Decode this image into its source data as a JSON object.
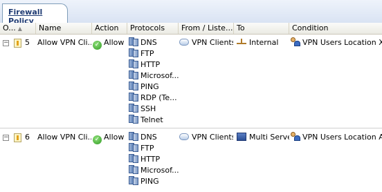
{
  "tab": {
    "label": "Firewall Policy"
  },
  "columns": {
    "order": "O...",
    "name": "Name",
    "action": "Action",
    "protocols": "Protocols",
    "from": "From / Liste...",
    "to": "To",
    "condition": "Condition"
  },
  "rules": [
    {
      "order": "5",
      "name": "Allow VPN Cli...",
      "action": "Allow",
      "protocols": [
        "DNS",
        "FTP",
        "HTTP",
        "Microsof...",
        "PING",
        "RDP (Te...",
        "SSH",
        "Telnet"
      ],
      "from": "VPN Clients",
      "to": "Internal",
      "to_icon": "network-icon",
      "condition": "VPN Users Location X"
    },
    {
      "order": "6",
      "name": "Allow VPN Cli...",
      "action": "Allow",
      "protocols": [
        "DNS",
        "FTP",
        "HTTP",
        "Microsof...",
        "PING"
      ],
      "from": "VPN Clients",
      "to": "Multi Server",
      "to_icon": "server-icon",
      "condition": "VPN Users Location Any"
    }
  ]
}
